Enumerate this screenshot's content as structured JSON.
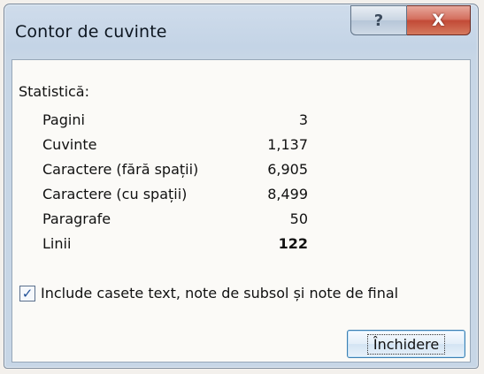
{
  "window": {
    "title": "Contor de cuvinte",
    "help_glyph": "?",
    "close_glyph": "X"
  },
  "statistics": {
    "section_label": "Statistică:",
    "rows": [
      {
        "label": "Pagini",
        "value": "3"
      },
      {
        "label": "Cuvinte",
        "value": "1,137"
      },
      {
        "label": "Caractere (fără spații)",
        "value": "6,905"
      },
      {
        "label": "Caractere (cu spații)",
        "value": "8,499"
      },
      {
        "label": "Paragrafe",
        "value": "50"
      },
      {
        "label": "Linii",
        "value": "122"
      }
    ]
  },
  "include_checkbox": {
    "checked": true,
    "check_glyph": "✓",
    "label": "Include casete text, note de subsol și note de final"
  },
  "buttons": {
    "close_label": "Închidere"
  }
}
